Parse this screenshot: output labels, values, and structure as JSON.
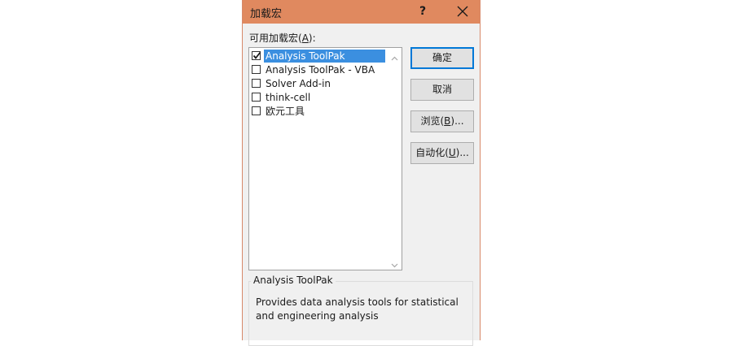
{
  "dialog": {
    "title": "加载宏",
    "help_label": "?",
    "list_label_prefix": "可用加载宏(",
    "list_label_key": "A",
    "list_label_suffix": "):"
  },
  "addins": [
    {
      "label": "Analysis ToolPak",
      "checked": true,
      "selected": true
    },
    {
      "label": "Analysis ToolPak - VBA",
      "checked": false,
      "selected": false
    },
    {
      "label": "Solver Add-in",
      "checked": false,
      "selected": false
    },
    {
      "label": "think-cell",
      "checked": false,
      "selected": false
    },
    {
      "label": "欧元工具",
      "checked": false,
      "selected": false
    }
  ],
  "buttons": {
    "ok": "确定",
    "cancel": "取消",
    "browse_prefix": "浏览(",
    "browse_key": "B",
    "browse_suffix": ")...",
    "automation_prefix": "自动化(",
    "automation_key": "U",
    "automation_suffix": ")..."
  },
  "details": {
    "title": "Analysis ToolPak",
    "description_line1": "Provides data analysis tools for statistical",
    "description_line2": "and engineering analysis"
  },
  "colors": {
    "titlebar": "#e0895f",
    "selection": "#3b8fe0",
    "default_button_border": "#0078d7"
  }
}
